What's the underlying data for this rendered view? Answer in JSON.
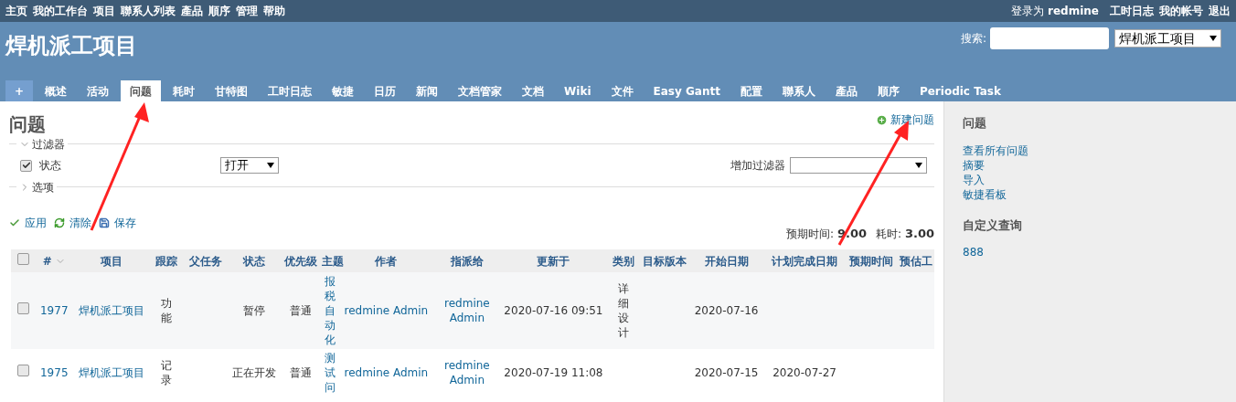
{
  "top_menu": {
    "items": [
      "主页",
      "我的工作台",
      "项目",
      "聯系人列表",
      "產品",
      "順序",
      "管理",
      "帮助"
    ],
    "logged_in_label": "登录为",
    "user": "redmine",
    "account_items": [
      "工时日志",
      "我的帐号",
      "退出"
    ]
  },
  "header": {
    "title": "焊机派工项目",
    "search_label": "搜索:",
    "project_select": "焊机派工项目"
  },
  "tabs": [
    {
      "label": "+",
      "kind": "new",
      "selected": false
    },
    {
      "label": "概述",
      "kind": "tab",
      "selected": false
    },
    {
      "label": "活动",
      "kind": "tab",
      "selected": false
    },
    {
      "label": "问题",
      "kind": "tab",
      "selected": true
    },
    {
      "label": "耗时",
      "kind": "tab",
      "selected": false
    },
    {
      "label": "甘特图",
      "kind": "tab",
      "selected": false
    },
    {
      "label": "工时日志",
      "kind": "tab",
      "selected": false
    },
    {
      "label": "敏捷",
      "kind": "tab",
      "selected": false
    },
    {
      "label": "日历",
      "kind": "tab",
      "selected": false
    },
    {
      "label": "新闻",
      "kind": "tab",
      "selected": false
    },
    {
      "label": "文档管家",
      "kind": "tab",
      "selected": false
    },
    {
      "label": "文档",
      "kind": "tab",
      "selected": false
    },
    {
      "label": "Wiki",
      "kind": "tab",
      "selected": false
    },
    {
      "label": "文件",
      "kind": "tab",
      "selected": false
    },
    {
      "label": "Easy Gantt",
      "kind": "tab",
      "selected": false
    },
    {
      "label": "配置",
      "kind": "tab",
      "selected": false
    },
    {
      "label": "聯系人",
      "kind": "tab",
      "selected": false
    },
    {
      "label": "產品",
      "kind": "tab",
      "selected": false
    },
    {
      "label": "順序",
      "kind": "tab",
      "selected": false
    },
    {
      "label": "Periodic Task",
      "kind": "tab",
      "selected": false
    }
  ],
  "page_title": "问题",
  "new_issue_link": "新建问题",
  "filters": {
    "legend": "过滤器",
    "expanded": true,
    "rows": [
      {
        "label": "状态",
        "checked": true,
        "operator": "打开"
      }
    ],
    "add_filter_label": "增加过滤器"
  },
  "options": {
    "legend": "选项",
    "expanded": false
  },
  "actions": [
    {
      "label": "应用",
      "kind": "apply"
    },
    {
      "label": "清除",
      "kind": "clear"
    },
    {
      "label": "保存",
      "kind": "save"
    }
  ],
  "totals": [
    {
      "label": "预期时间:",
      "value": "9.00"
    },
    {
      "label": "耗时:",
      "value": "3.00"
    }
  ],
  "table": {
    "all_checked": false,
    "columns": [
      {
        "label": "#",
        "kind": "link",
        "sort": true
      },
      {
        "label": "项目",
        "kind": "link"
      },
      {
        "label": "跟踪",
        "kind": "text"
      },
      {
        "label": "父任务"
      },
      {
        "label": "状态",
        "kind": "text"
      },
      {
        "label": "优先级",
        "kind": "text"
      },
      {
        "label": "主题",
        "kind": "link"
      },
      {
        "label": "作者",
        "kind": "link"
      },
      {
        "label": "指派给",
        "kind": "link"
      },
      {
        "label": "更新于",
        "kind": "text"
      },
      {
        "label": "类别",
        "kind": "text"
      },
      {
        "label": "目标版本"
      },
      {
        "label": "开始日期",
        "kind": "text"
      },
      {
        "label": "计划完成日期",
        "kind": "text"
      },
      {
        "label": "预期时间"
      },
      {
        "label": "预估工"
      }
    ],
    "rows": [
      {
        "checked": false,
        "cells": [
          "1977",
          "焊机派工项目",
          "功能",
          "",
          "暂停",
          "普通",
          "报税自动化",
          "redmine Admin",
          "redmine Admin",
          "2020-07-16 09:51",
          "详细设计",
          "",
          "2020-07-16",
          "",
          "",
          ""
        ]
      },
      {
        "checked": false,
        "cells": [
          "1975",
          "焊机派工项目",
          "记录",
          "",
          "正在开发",
          "普通",
          "测试问",
          "redmine Admin",
          "redmine Admin",
          "2020-07-19 11:08",
          "",
          "",
          "2020-07-15",
          "2020-07-27",
          "",
          ""
        ]
      }
    ]
  },
  "sidebar": {
    "sections": [
      {
        "title": "问题",
        "links": [
          "查看所有问题",
          "摘要",
          "导入",
          "敏捷看板"
        ]
      },
      {
        "title": "自定义查询",
        "links": [
          "888"
        ]
      }
    ]
  }
}
